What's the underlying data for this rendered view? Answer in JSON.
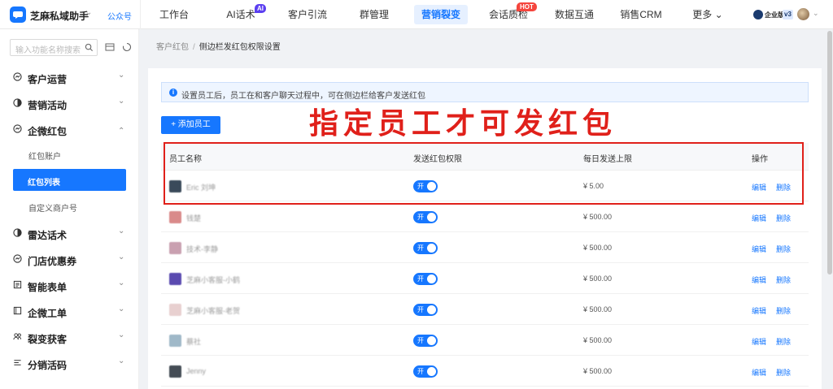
{
  "topbar": {
    "app_name": "芝麻私域助手",
    "account_link": "公众号",
    "nav": [
      {
        "label": "工作台"
      },
      {
        "label": "AI话术",
        "badge": "AI"
      },
      {
        "label": "客户引流"
      },
      {
        "label": "群管理"
      },
      {
        "label": "营销裂变",
        "active": true
      },
      {
        "label": "会话质检",
        "badge": "HOT"
      },
      {
        "label": "数据互通"
      },
      {
        "label": "销售CRM"
      },
      {
        "label": "更多"
      }
    ],
    "corp_label": "企业版",
    "version": "v3"
  },
  "sidebar": {
    "search_placeholder": "输入功能名称搜索",
    "menu": [
      {
        "label": "客户运营",
        "icon": "customer-ops-icon",
        "expanded": false
      },
      {
        "label": "营销活动",
        "icon": "campaign-icon",
        "expanded": false
      },
      {
        "label": "企微红包",
        "icon": "red-packet-icon",
        "expanded": true,
        "children": [
          {
            "label": "红包账户"
          },
          {
            "label": "红包列表",
            "active": true
          },
          {
            "label": "自定义商户号"
          }
        ]
      },
      {
        "label": "雷达话术",
        "icon": "radar-icon",
        "expanded": false
      },
      {
        "label": "门店优惠券",
        "icon": "coupon-icon",
        "expanded": false
      },
      {
        "label": "智能表单",
        "icon": "form-icon",
        "expanded": false
      },
      {
        "label": "企微工单",
        "icon": "ticket-icon",
        "expanded": false
      },
      {
        "label": "裂变获客",
        "icon": "fission-icon",
        "expanded": false
      },
      {
        "label": "分销活码",
        "icon": "distribution-icon",
        "expanded": false
      }
    ]
  },
  "breadcrumb": {
    "parent": "客户红包",
    "separator": "/",
    "current": "侧边栏发红包权限设置"
  },
  "notice": "设置员工后，员工在和客户聊天过程中，可在侧边栏给客户发送红包",
  "add_button": "+ 添加员工",
  "annotation": "指定员工才可发红包",
  "table": {
    "headers": [
      "员工名称",
      "发送红包权限",
      "每日发送上限",
      "操作"
    ],
    "rows": [
      {
        "name": "Eric 刘坤",
        "toggle": "开",
        "limit": "¥ 5.00",
        "edit": "编辑",
        "delete": "删除",
        "avatar_color": "#3a4a5a"
      },
      {
        "name": "钱楚",
        "toggle": "开",
        "limit": "¥ 500.00",
        "edit": "编辑",
        "delete": "删除",
        "avatar_color": "#d98a8a"
      },
      {
        "name": "技术-李静",
        "toggle": "开",
        "limit": "¥ 500.00",
        "edit": "编辑",
        "delete": "删除",
        "avatar_color": "#c9a0b0"
      },
      {
        "name": "芝麻小客服-小鹤",
        "toggle": "开",
        "limit": "¥ 500.00",
        "edit": "编辑",
        "delete": "删除",
        "avatar_color": "#5a4ab0"
      },
      {
        "name": "芝麻小客服-老贺",
        "toggle": "开",
        "limit": "¥ 500.00",
        "edit": "编辑",
        "delete": "删除",
        "avatar_color": "#e8d0d0"
      },
      {
        "name": "蔡社",
        "toggle": "开",
        "limit": "¥ 500.00",
        "edit": "编辑",
        "delete": "删除",
        "avatar_color": "#9fb8c8"
      },
      {
        "name": "Jenny",
        "toggle": "开",
        "limit": "¥ 500.00",
        "edit": "编辑",
        "delete": "删除",
        "avatar_color": "#444c55"
      }
    ]
  },
  "colors": {
    "accent": "#1677ff",
    "annotation": "#e0201a"
  }
}
